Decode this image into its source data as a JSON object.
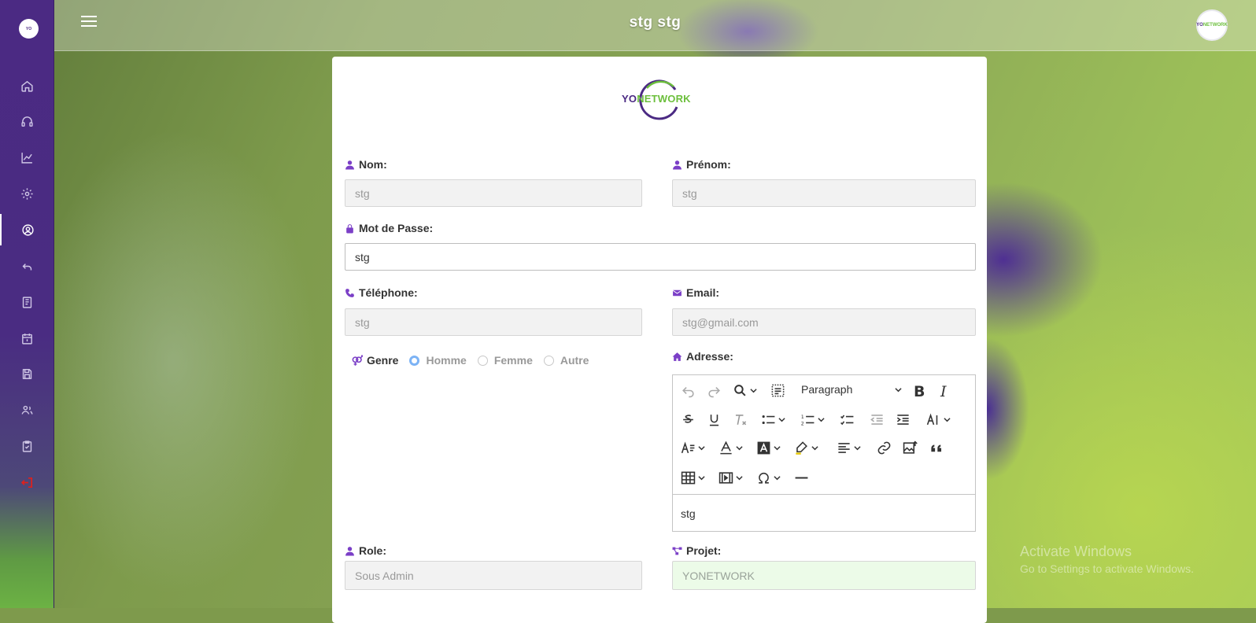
{
  "topbar": {
    "title": "stg stg"
  },
  "sidebar": {
    "items": [
      {
        "name": "home",
        "icon": "home-icon"
      },
      {
        "name": "support",
        "icon": "headset-icon"
      },
      {
        "name": "stats",
        "icon": "chart-line-icon"
      },
      {
        "name": "settings",
        "icon": "gear-icon"
      },
      {
        "name": "profile",
        "icon": "user-circle-icon",
        "active": true
      },
      {
        "name": "back",
        "icon": "reply-icon"
      },
      {
        "name": "documents",
        "icon": "book-icon"
      },
      {
        "name": "calendar",
        "icon": "calendar-icon"
      },
      {
        "name": "save",
        "icon": "floppy-icon"
      },
      {
        "name": "users",
        "icon": "users-icon"
      },
      {
        "name": "tasks",
        "icon": "clipboard-check-icon"
      },
      {
        "name": "logout",
        "icon": "logout-icon"
      }
    ]
  },
  "logo": {
    "yo": "YO",
    "network": "NETWORK"
  },
  "form": {
    "nom": {
      "label": "Nom:",
      "value": "stg"
    },
    "prenom": {
      "label": "Prénom:",
      "value": "stg"
    },
    "password": {
      "label": "Mot de Passe:",
      "value": "stg"
    },
    "telephone": {
      "label": "Téléphone:",
      "value": "stg"
    },
    "email": {
      "label": "Email:",
      "value": "stg@gmail.com"
    },
    "genre": {
      "label": "Genre",
      "options": [
        "Homme",
        "Femme",
        "Autre"
      ],
      "selected": "Homme"
    },
    "adresse": {
      "label": "Adresse:",
      "paragraph": "Paragraph",
      "content": "stg"
    },
    "role": {
      "label": "Role:",
      "value": "Sous Admin"
    },
    "projet": {
      "label": "Projet:",
      "value": "YONETWORK"
    }
  },
  "colors": {
    "sidebar": "#4b2a83",
    "icon_accent": "#7b3fc7",
    "logout": "#e0201b",
    "projet_bg": "#ecfbe8"
  },
  "watermark": {
    "line1": "Activate Windows",
    "line2": "Go to Settings to activate Windows."
  }
}
